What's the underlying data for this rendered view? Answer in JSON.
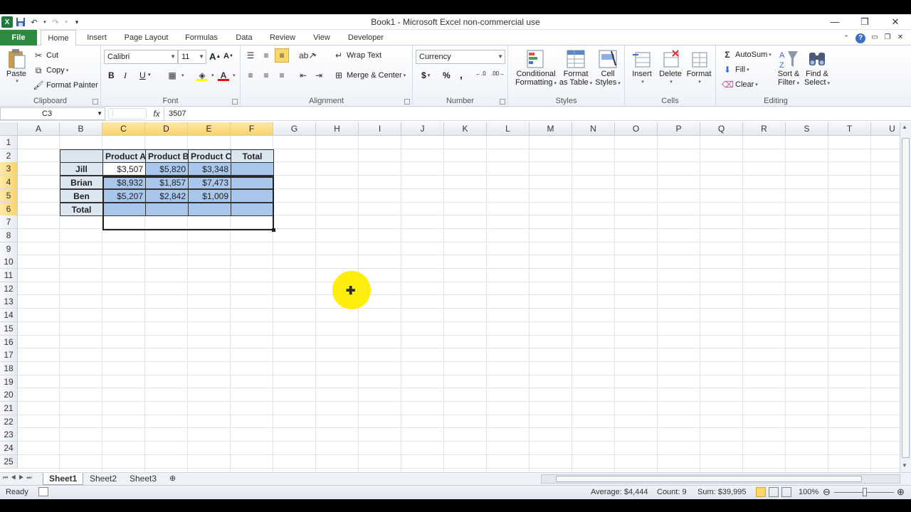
{
  "titlebar": {
    "title": "Book1  -  Microsoft Excel non-commercial use",
    "minimize": "—",
    "restore": "❐",
    "close": "✕"
  },
  "tabs": [
    "File",
    "Home",
    "Insert",
    "Page Layout",
    "Formulas",
    "Data",
    "Review",
    "View",
    "Developer"
  ],
  "ribbon": {
    "clipboard": {
      "label": "Clipboard",
      "paste": "Paste",
      "cut": "Cut",
      "copy": "Copy",
      "format_painter": "Format Painter"
    },
    "font": {
      "label": "Font",
      "name": "Calibri",
      "size": "11",
      "bold": "B",
      "italic": "I",
      "underline": "U"
    },
    "alignment": {
      "label": "Alignment",
      "wrap": "Wrap Text",
      "merge": "Merge & Center"
    },
    "number": {
      "label": "Number",
      "format": "Currency",
      "dollar": "$",
      "percent": "%",
      "comma": ","
    },
    "styles": {
      "label": "Styles",
      "cond_1": "Conditional",
      "cond_2": "Formatting",
      "fmt_1": "Format",
      "fmt_2": "as Table",
      "cell_1": "Cell",
      "cell_2": "Styles"
    },
    "cells": {
      "label": "Cells",
      "insert": "Insert",
      "delete": "Delete",
      "format": "Format"
    },
    "editing": {
      "label": "Editing",
      "autosum": "AutoSum",
      "fill": "Fill",
      "clear": "Clear",
      "sort_1": "Sort &",
      "sort_2": "Filter",
      "find_1": "Find &",
      "find_2": "Select"
    }
  },
  "formula_bar": {
    "name_box": "C3",
    "fx": "fx",
    "content": "3507"
  },
  "columns": [
    "A",
    "B",
    "C",
    "D",
    "E",
    "F",
    "G",
    "H",
    "I",
    "J",
    "K",
    "L",
    "M",
    "N",
    "O",
    "P",
    "Q",
    "R",
    "S",
    "T",
    "U"
  ],
  "rows": [
    "1",
    "2",
    "3",
    "4",
    "5",
    "6",
    "7",
    "8",
    "9",
    "10",
    "11",
    "12",
    "13",
    "14",
    "15",
    "16",
    "17",
    "18",
    "19",
    "20",
    "21",
    "22",
    "23",
    "24",
    "25"
  ],
  "table": {
    "headers": [
      "Product A",
      "Product B",
      "Product C",
      "Total"
    ],
    "rows": [
      {
        "name": "Jill",
        "values": [
          "$3,507",
          "$5,820",
          "$3,348",
          ""
        ]
      },
      {
        "name": "Brian",
        "values": [
          "$8,932",
          "$1,857",
          "$7,473",
          ""
        ]
      },
      {
        "name": "Ben",
        "values": [
          "$5,207",
          "$2,842",
          "$1,009",
          ""
        ]
      },
      {
        "name": "Total",
        "values": [
          "",
          "",
          "",
          ""
        ]
      }
    ]
  },
  "sheets": [
    "Sheet1",
    "Sheet2",
    "Sheet3"
  ],
  "status": {
    "ready": "Ready",
    "average": "Average: $4,444",
    "count": "Count: 9",
    "sum": "Sum: $39,995",
    "zoom": "100%"
  }
}
